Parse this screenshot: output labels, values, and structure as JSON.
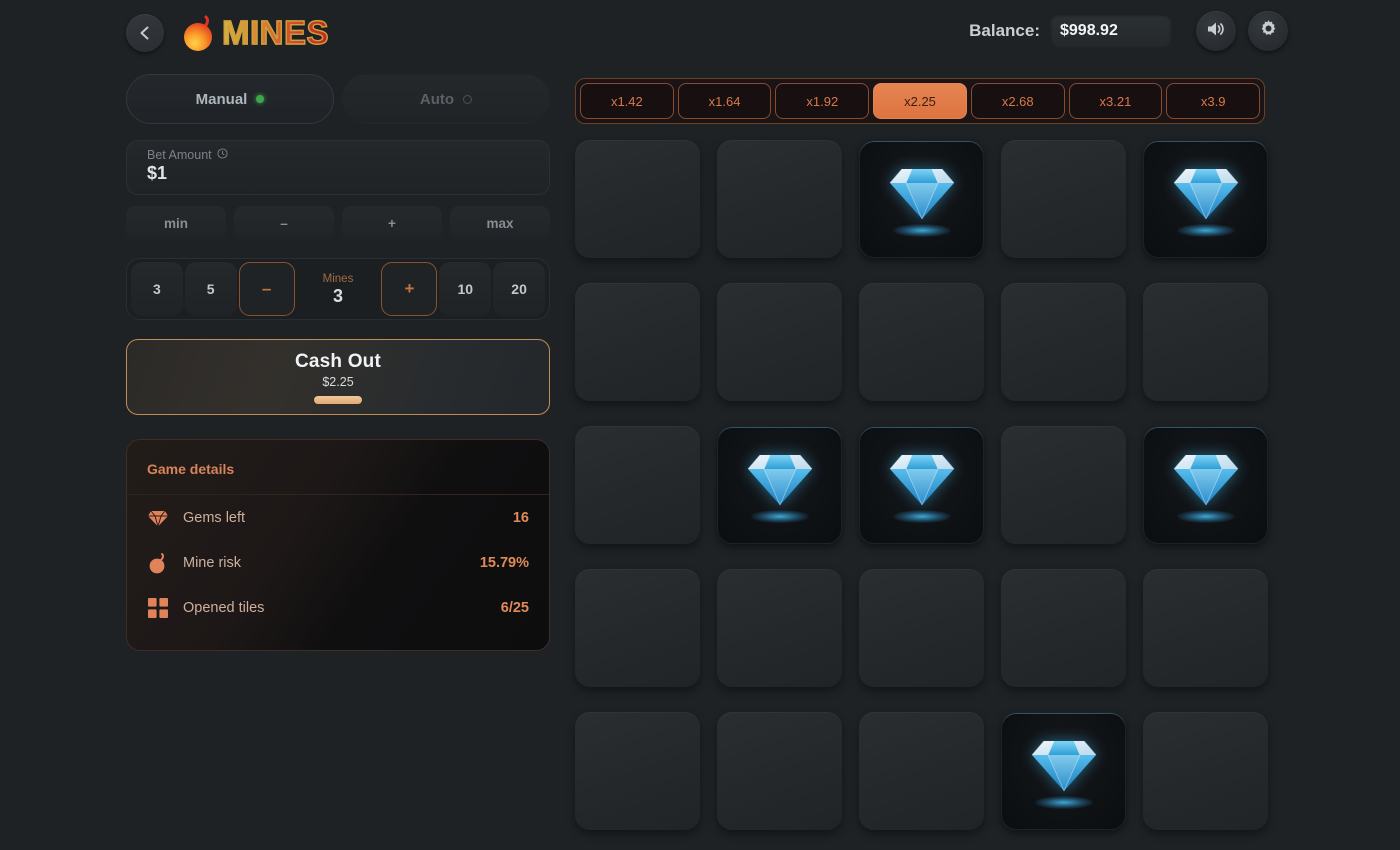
{
  "header": {
    "back_icon": "chevron-left-icon",
    "logo_icon": "bomb-icon",
    "logo_text": "MINES",
    "balance_label": "Balance:",
    "balance_value": "$998.92",
    "sound_icon": "speaker-icon",
    "settings_icon": "gear-icon"
  },
  "tabs": [
    {
      "label": "Manual",
      "active": true,
      "indicator": "green-dot"
    },
    {
      "label": "Auto",
      "active": false,
      "indicator": "grey-circle"
    }
  ],
  "bet": {
    "label": "Bet Amount",
    "info_icon": "info-icon",
    "value": "$1",
    "buttons": [
      "min",
      "–",
      "+",
      "max"
    ]
  },
  "mines": {
    "presets_left": [
      "3",
      "5"
    ],
    "decrement": "–",
    "caption": "Mines",
    "value": "3",
    "increment": "+",
    "presets_right": [
      "10",
      "20"
    ]
  },
  "cashout": {
    "title": "Cash Out",
    "amount": "$2.25"
  },
  "details": {
    "title": "Game details",
    "rows": [
      {
        "icon": "diamond-icon",
        "label": "Gems left",
        "value": "16"
      },
      {
        "icon": "bomb-icon",
        "label": "Mine risk",
        "value": "15.79%"
      },
      {
        "icon": "grid-icon",
        "label": "Opened tiles",
        "value": "6/25"
      }
    ]
  },
  "multipliers": [
    {
      "label": "x1.42",
      "active": false
    },
    {
      "label": "x1.64",
      "active": false
    },
    {
      "label": "x1.92",
      "active": false
    },
    {
      "label": "x2.25",
      "active": true
    },
    {
      "label": "x2.68",
      "active": false
    },
    {
      "label": "x3.21",
      "active": false
    },
    {
      "label": "x3.9",
      "active": false
    }
  ],
  "board": {
    "rows": 5,
    "cols": 5,
    "tiles": [
      "closed",
      "closed",
      "gem",
      "closed",
      "gem",
      "closed",
      "closed",
      "closed",
      "closed",
      "closed",
      "closed",
      "gem",
      "gem",
      "closed",
      "gem",
      "closed",
      "closed",
      "closed",
      "closed",
      "closed",
      "closed",
      "closed",
      "closed",
      "gem",
      "closed"
    ]
  },
  "colors": {
    "background": "#1e2225",
    "accent": "#e07b4a",
    "tile_closed": "#272b2e",
    "tile_revealed": "#0e1114",
    "gem": "#49b8ec",
    "green": "#3ea64a"
  }
}
